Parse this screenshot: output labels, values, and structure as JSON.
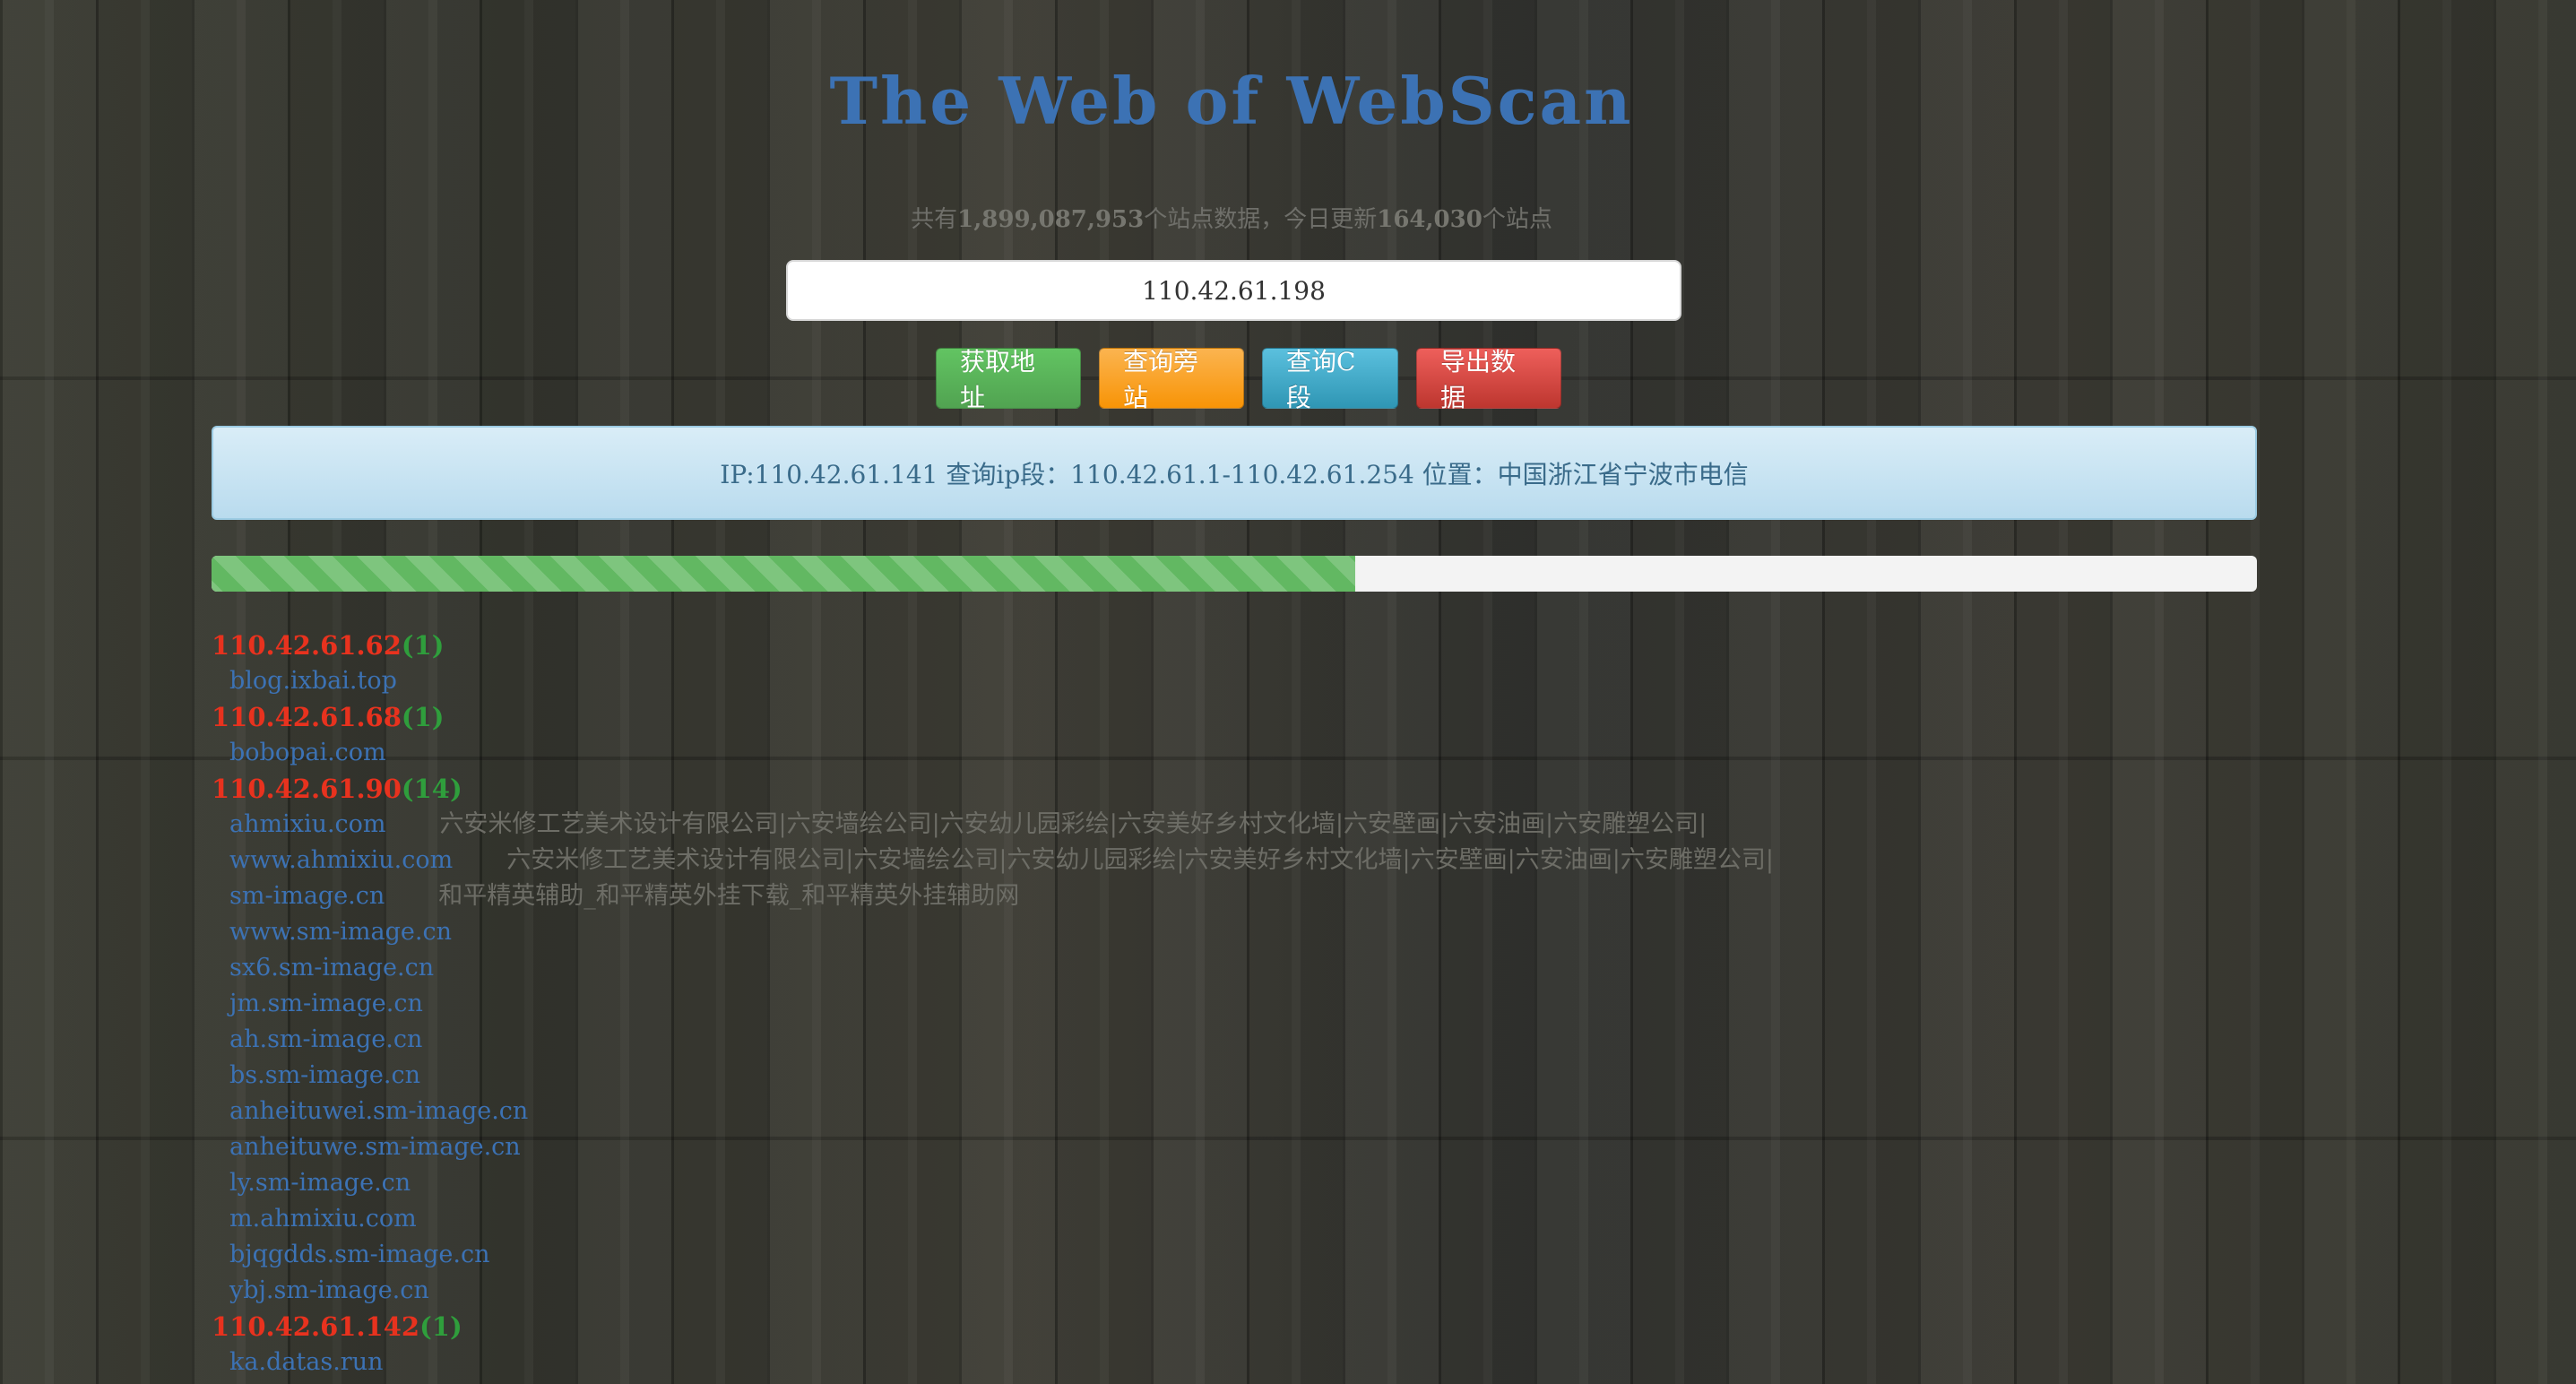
{
  "header": {
    "title": "The Web of WebScan",
    "stats_prefix": "共有",
    "stats_total": "1,899,087,953",
    "stats_mid": "个站点数据，今日更新",
    "stats_today": "164,030",
    "stats_suffix": "个站点"
  },
  "search": {
    "value": "110.42.61.198"
  },
  "buttons": {
    "get_address": "获取地址",
    "query_sites": "查询旁站",
    "query_c": "查询C段",
    "export": "导出数据"
  },
  "colors": {
    "title": "#3c72b4",
    "ip": "#e8321e",
    "count": "#2f9e3c",
    "domain": "#3c72b4",
    "btn_green": "#5bb75b",
    "btn_orange": "#faa732",
    "btn_blue": "#49afcd",
    "btn_red": "#da4f49"
  },
  "info": {
    "text": "IP:110.42.61.141 查询ip段：110.42.61.1-110.42.61.254 位置：中国浙江省宁波市电信"
  },
  "progress": {
    "fraction": 0.559
  },
  "results": [
    {
      "ip": "110.42.61.62",
      "count": "(1)",
      "sites": [
        {
          "domain": "blog.ixbai.top",
          "title": ""
        }
      ]
    },
    {
      "ip": "110.42.61.68",
      "count": "(1)",
      "sites": [
        {
          "domain": "bobopai.com",
          "title": ""
        }
      ]
    },
    {
      "ip": "110.42.61.90",
      "count": "(14)",
      "sites": [
        {
          "domain": "ahmixiu.com",
          "title": "六安米修工艺美术设计有限公司|六安墙绘公司|六安幼儿园彩绘|六安美好乡村文化墙|六安壁画|六安油画|六安雕塑公司|"
        },
        {
          "domain": "www.ahmixiu.com",
          "title": "六安米修工艺美术设计有限公司|六安墙绘公司|六安幼儿园彩绘|六安美好乡村文化墙|六安壁画|六安油画|六安雕塑公司|"
        },
        {
          "domain": "sm-image.cn",
          "title": "和平精英辅助_和平精英外挂下载_和平精英外挂辅助网"
        },
        {
          "domain": "www.sm-image.cn",
          "title": ""
        },
        {
          "domain": "sx6.sm-image.cn",
          "title": ""
        },
        {
          "domain": "jm.sm-image.cn",
          "title": ""
        },
        {
          "domain": "ah.sm-image.cn",
          "title": ""
        },
        {
          "domain": "bs.sm-image.cn",
          "title": ""
        },
        {
          "domain": "anheituwei.sm-image.cn",
          "title": ""
        },
        {
          "domain": "anheituwe.sm-image.cn",
          "title": ""
        },
        {
          "domain": "ly.sm-image.cn",
          "title": ""
        },
        {
          "domain": "m.ahmixiu.com",
          "title": ""
        },
        {
          "domain": "bjqgdds.sm-image.cn",
          "title": ""
        },
        {
          "domain": "ybj.sm-image.cn",
          "title": ""
        }
      ]
    },
    {
      "ip": "110.42.61.142",
      "count": "(1)",
      "sites": [
        {
          "domain": "ka.datas.run",
          "title": ""
        }
      ]
    }
  ]
}
